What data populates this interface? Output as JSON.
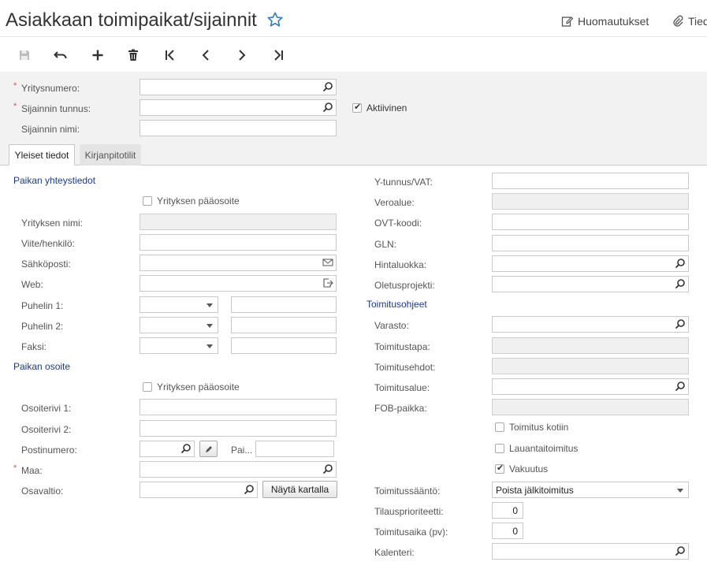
{
  "header": {
    "title": "Asiakkaan toimipaikat/sijainnit",
    "notes_label": "Huomautukset",
    "files_label": "Tied"
  },
  "toolbar": {
    "icons": [
      "save-icon",
      "undo-icon",
      "add-icon",
      "delete-icon",
      "first-icon",
      "prev-icon",
      "next-icon",
      "last-icon"
    ]
  },
  "top_form": {
    "customer_number_label": "Yritysnumero:",
    "location_id_label": "Sijainnin tunnus:",
    "location_name_label": "Sijainnin nimi:",
    "active_label": "Aktiivinen",
    "active_checked": true,
    "required_mark": "*"
  },
  "tabs": [
    {
      "label": "Yleiset tiedot",
      "active": true
    },
    {
      "label": "Kirjanpitotilit",
      "active": false
    }
  ],
  "left": {
    "contact_section": "Paikan yhteystiedot",
    "main_address_label": "Yrityksen pääosoite",
    "company_name_label": "Yrityksen nimi:",
    "attention_label": "Viite/henkilö:",
    "email_label": "Sähköposti:",
    "web_label": "Web:",
    "phone1_label": "Puhelin 1:",
    "phone2_label": "Puhelin 2:",
    "fax_label": "Faksi:",
    "address_section": "Paikan osoite",
    "main_address_label2": "Yrityksen pääosoite",
    "address1_label": "Osoiterivi 1:",
    "address2_label": "Osoiterivi 2:",
    "postal_label": "Postinumero:",
    "city_label": "Pai...",
    "country_label": "Maa:",
    "state_label": "Osavaltio:",
    "map_button": "Näytä kartalla"
  },
  "right": {
    "vat_label": "Y-tunnus/VAT:",
    "tax_zone_label": "Veroalue:",
    "ovt_label": "OVT-koodi:",
    "gln_label": "GLN:",
    "price_class_label": "Hintaluokka:",
    "default_project_label": "Oletusprojekti:",
    "shipping_section": "Toimitusohjeet",
    "warehouse_label": "Varasto:",
    "ship_via_label": "Toimitustapa:",
    "ship_terms_label": "Toimitusehdot:",
    "ship_zone_label": "Toimitusalue:",
    "fob_label": "FOB-paikka:",
    "residential_label": "Toimitus kotiin",
    "residential_checked": false,
    "saturday_label": "Lauantaitoimitus",
    "saturday_checked": false,
    "insurance_label": "Vakuutus",
    "insurance_checked": true,
    "ship_rule_label": "Toimitussääntö:",
    "ship_rule_value": "Poista jälkitoimitus",
    "order_priority_label": "Tilausprioriteetti:",
    "order_priority_value": "0",
    "lead_time_label": "Toimitusaika (pv):",
    "lead_time_value": "0",
    "calendar_label": "Kalenteri:"
  },
  "colors": {
    "section_blue": "#1a3a8a",
    "required_red": "#d9534f",
    "star_blue": "#2f7fc1"
  }
}
